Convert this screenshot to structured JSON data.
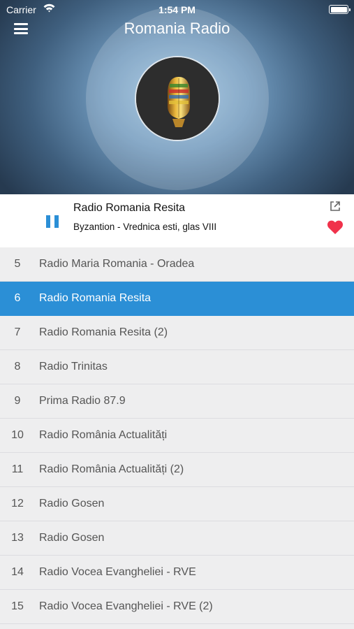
{
  "status_bar": {
    "carrier": "Carrier",
    "time": "1:54 PM"
  },
  "header": {
    "title": "Romania Radio",
    "menu_icon": "hamburger-menu-icon"
  },
  "artwork": {
    "logo_icon": "microphone-icon"
  },
  "now_playing": {
    "station": "Radio Romania Resita",
    "track": "Byzantion - Vrednica esti, glas VIII",
    "state": "playing",
    "play_icon": "pause-icon",
    "share_icon": "share-icon",
    "favorite_icon": "heart-icon",
    "favorited": true
  },
  "colors": {
    "accent": "#2b8fd6",
    "heart": "#f0324b",
    "list_bg": "#eeeeef"
  },
  "stations": [
    {
      "num": "5",
      "name": "Radio Maria Romania - Oradea"
    },
    {
      "num": "6",
      "name": "Radio Romania Resita",
      "active": true
    },
    {
      "num": "7",
      "name": "Radio Romania Resita (2)"
    },
    {
      "num": "8",
      "name": "Radio Trinitas"
    },
    {
      "num": "9",
      "name": "Prima Radio 87.9"
    },
    {
      "num": "10",
      "name": "Radio România Actualități"
    },
    {
      "num": "11",
      "name": "Radio România Actualități (2)"
    },
    {
      "num": "12",
      "name": "Radio Gosen"
    },
    {
      "num": "13",
      "name": "Radio Gosen"
    },
    {
      "num": "14",
      "name": "Radio Vocea Evangheliei - RVE"
    },
    {
      "num": "15",
      "name": "Radio Vocea Evangheliei - RVE (2)"
    }
  ]
}
